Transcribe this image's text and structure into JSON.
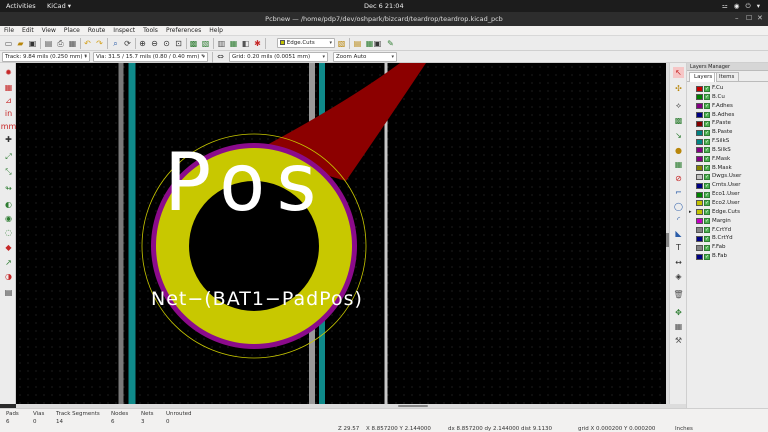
{
  "system": {
    "activities": "Activities",
    "app_menu": "KiCad ▾",
    "clock": "Dec 6  21:04",
    "tray": "⚍ ◉ ⏻ ▾"
  },
  "window": {
    "title": "Pcbnew — /home/pdp7/dev/oshpark/bizcard/teardrop/teardrop.kicad_pcb",
    "minimize": "–",
    "maximize": "☐",
    "close": "✕"
  },
  "menu": [
    "File",
    "Edit",
    "View",
    "Place",
    "Route",
    "Inspect",
    "Tools",
    "Preferences",
    "Help"
  ],
  "toolbar": {
    "layer_combo": "Edge.Cuts"
  },
  "options": {
    "track": "Track: 9.84 mils (0.250 mm) *",
    "via": "Via: 31.5 / 15.7 mils (0.80 / 0.40 mm) *",
    "grid": "Grid: 0.20 mils (0.0051 mm)",
    "zoom": "Zoom Auto"
  },
  "canvas": {
    "pad_label": "Pos",
    "net_label": "Net−(BAT1−PadPos)"
  },
  "colors": {
    "copper": "#c8c800",
    "mask": "#8b0b8b",
    "track": "#8c0000",
    "edge": "#c8c8c8",
    "zone": "#0f8a8a",
    "silk": "#ffffff",
    "courtyard": "#b9b900"
  },
  "layer_manager": {
    "title": "Layers Manager",
    "tabs": [
      "Layers",
      "Items"
    ],
    "layers": [
      {
        "name": "F.Cu",
        "color": "#c80000"
      },
      {
        "name": "B.Cu",
        "color": "#008000"
      },
      {
        "name": "F.Adhes",
        "color": "#840084"
      },
      {
        "name": "B.Adhes",
        "color": "#000084"
      },
      {
        "name": "F.Paste",
        "color": "#840000"
      },
      {
        "name": "B.Paste",
        "color": "#008080"
      },
      {
        "name": "F.SilkS",
        "color": "#008484"
      },
      {
        "name": "B.SilkS",
        "color": "#840084"
      },
      {
        "name": "F.Mask",
        "color": "#840084"
      },
      {
        "name": "B.Mask",
        "color": "#848400"
      },
      {
        "name": "Dwgs.User",
        "color": "#c2c2c2"
      },
      {
        "name": "Cmts.User",
        "color": "#000084"
      },
      {
        "name": "Eco1.User",
        "color": "#008400"
      },
      {
        "name": "Eco2.User",
        "color": "#c2c200"
      },
      {
        "name": "Edge.Cuts",
        "color": "#c2c200"
      },
      {
        "name": "Margin",
        "color": "#c200c2"
      },
      {
        "name": "F.CrtYd",
        "color": "#848484"
      },
      {
        "name": "B.CrtYd",
        "color": "#000084"
      },
      {
        "name": "F.Fab",
        "color": "#848484"
      },
      {
        "name": "B.Fab",
        "color": "#000084"
      }
    ]
  },
  "status": {
    "pads_label": "Pads",
    "pads": "6",
    "vias_label": "Vias",
    "vias": "0",
    "tracks_label": "Track Segments",
    "tracks": "14",
    "nodes_label": "Nodes",
    "nodes": "6",
    "nets_label": "Nets",
    "nets": "3",
    "unrouted_label": "Unrouted",
    "unrouted": "0",
    "zoom": "Z 29.57",
    "xy": "X 8.857200  Y 2.144000",
    "dxdy": "dx 8.857200  dy 2.144000  dist 9.1130",
    "grid": "grid X 0.000200  Y 0.000200",
    "units": "Inches"
  }
}
